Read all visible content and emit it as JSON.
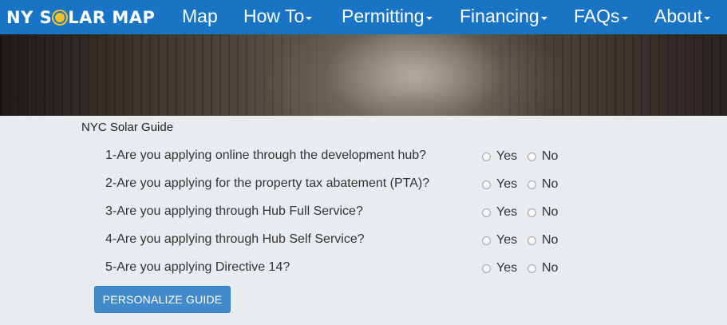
{
  "navbar": {
    "brand": {
      "before": "NY S",
      "after": "LAR MAP"
    },
    "items": [
      {
        "label": "Map",
        "dropdown": false
      },
      {
        "label": "How To",
        "dropdown": true
      },
      {
        "label": "Permitting",
        "dropdown": true
      },
      {
        "label": "Financing",
        "dropdown": true
      },
      {
        "label": "FAQs",
        "dropdown": true
      },
      {
        "label": "About",
        "dropdown": true
      }
    ]
  },
  "guide": {
    "title": "NYC Solar Guide",
    "yes_label": "Yes",
    "no_label": "No",
    "questions": [
      "1-Are you applying online through the development hub?",
      "2-Are you applying for the property tax abatement (PTA)?",
      "3-Are you applying through Hub Full Service?",
      "4-Are you applying through Hub Self Service?",
      "5-Are you applying Directive 14?"
    ],
    "button_label": "PERSONALIZE GUIDE"
  },
  "colors": {
    "nav_blue": "#1a74c6",
    "sun_yellow": "#f6c22b",
    "button_blue": "#428bca",
    "page_bg": "#e8ecee"
  }
}
